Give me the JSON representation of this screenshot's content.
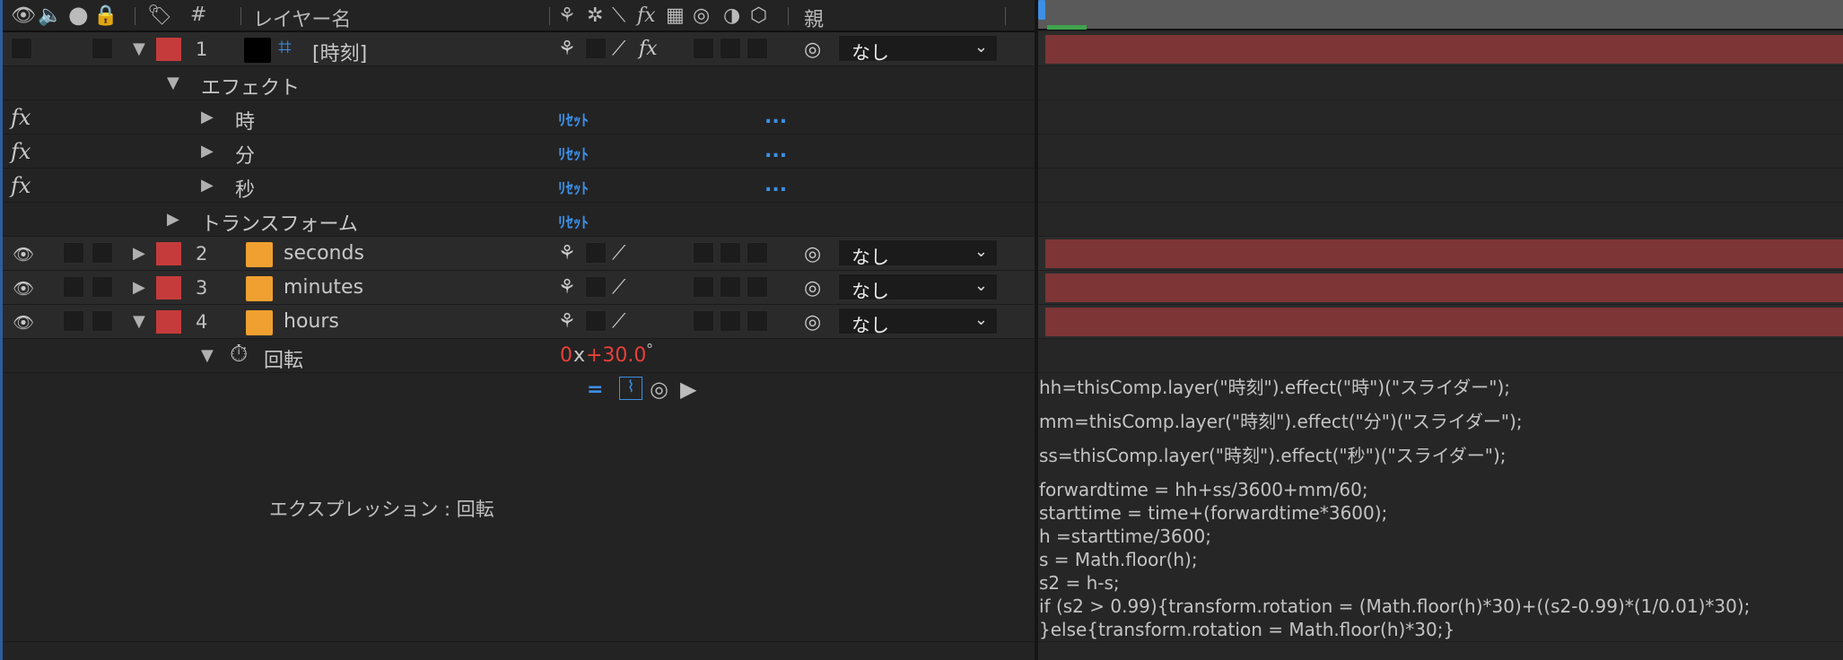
{
  "header": {
    "hash": "#",
    "layer_name": "レイヤー名",
    "parent": "親"
  },
  "layers": [
    {
      "num": "1",
      "name": "[時刻]",
      "parent": "なし",
      "expanded": true,
      "swatch": "#000000",
      "label_color": "#c53b3b"
    },
    {
      "num": "2",
      "name": "seconds",
      "parent": "なし",
      "expanded": false,
      "swatch": "#f0a030",
      "label_color": "#c53b3b"
    },
    {
      "num": "3",
      "name": "minutes",
      "parent": "なし",
      "expanded": false,
      "swatch": "#f0a030",
      "label_color": "#c53b3b"
    },
    {
      "num": "4",
      "name": "hours",
      "parent": "なし",
      "expanded": true,
      "swatch": "#f0a030",
      "label_color": "#c53b3b"
    }
  ],
  "effects_group": {
    "label": "エフェクト"
  },
  "effects": [
    {
      "name": "時",
      "reset": "ﾘｾｯﾄ",
      "more": "..."
    },
    {
      "name": "分",
      "reset": "ﾘｾｯﾄ",
      "more": "..."
    },
    {
      "name": "秒",
      "reset": "ﾘｾｯﾄ",
      "more": "..."
    }
  ],
  "transform": {
    "label": "トランスフォーム",
    "reset": "ﾘｾｯﾄ"
  },
  "rotation": {
    "label": "回転",
    "value_turns": "0",
    "value_x": "x",
    "value_deg": "+30.0",
    "value_unit": "°"
  },
  "expression_label": "エクスプレッション : 回転",
  "expression_lines": [
    "hh=thisComp.layer(\"時刻\").effect(\"時\")(\"スライダー\");",
    "mm=thisComp.layer(\"時刻\").effect(\"分\")(\"スライダー\");",
    "ss=thisComp.layer(\"時刻\").effect(\"秒\")(\"スライダー\");",
    "forwardtime = hh+ss/3600+mm/60;",
    "starttime = time+(forwardtime*3600);",
    "h =starttime/3600;",
    "s = Math.floor(h);",
    "s2 = h-s;",
    "if (s2 > 0.99){transform.rotation = (Math.floor(h)*30)+((s2-0.99)*(1/0.01)*30);",
    "}else{transform.rotation = Math.floor(h)*30;}"
  ],
  "colors": {
    "accent_blue": "#3d8fe6",
    "label_red": "#c53b3b",
    "track_bar": "#7d3536",
    "value_red": "#e8403a"
  },
  "icons": {
    "fx": "fx-icon",
    "eye": "eye-icon",
    "stopwatch": "stopwatch-icon",
    "pickwhip": "pickwhip-icon"
  }
}
